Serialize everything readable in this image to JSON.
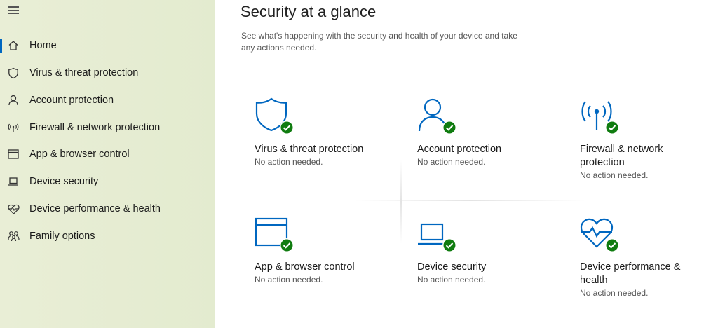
{
  "colors": {
    "accent": "#0067c0",
    "check_green": "#107c10",
    "sidebar_bg": "#e6edd2"
  },
  "sidebar": {
    "menu_icon": "hamburger-icon",
    "items": [
      {
        "label": "Home",
        "icon": "home-icon",
        "active": true
      },
      {
        "label": "Virus & threat protection",
        "icon": "shield-icon",
        "active": false
      },
      {
        "label": "Account protection",
        "icon": "person-icon",
        "active": false
      },
      {
        "label": "Firewall & network protection",
        "icon": "wifi-antenna-icon",
        "active": false
      },
      {
        "label": "App & browser control",
        "icon": "browser-window-icon",
        "active": false
      },
      {
        "label": "Device security",
        "icon": "laptop-icon",
        "active": false
      },
      {
        "label": "Device performance & health",
        "icon": "heart-pulse-icon",
        "active": false
      },
      {
        "label": "Family options",
        "icon": "family-icon",
        "active": false
      }
    ]
  },
  "main": {
    "title": "Security at a glance",
    "subtitle": "See what's happening with the security and health of your device and take any actions needed.",
    "cards": [
      {
        "title": "Virus & threat protection",
        "status": "No action needed.",
        "icon": "shield-icon"
      },
      {
        "title": "Account protection",
        "status": "No action needed.",
        "icon": "person-icon"
      },
      {
        "title": "Firewall & network protection",
        "status": "No action needed.",
        "icon": "wifi-antenna-icon"
      },
      {
        "title": "App & browser control",
        "status": "No action needed.",
        "icon": "browser-window-icon"
      },
      {
        "title": "Device security",
        "status": "No action needed.",
        "icon": "laptop-icon"
      },
      {
        "title": "Device performance & health",
        "status": "No action needed.",
        "icon": "heart-pulse-icon"
      }
    ]
  }
}
